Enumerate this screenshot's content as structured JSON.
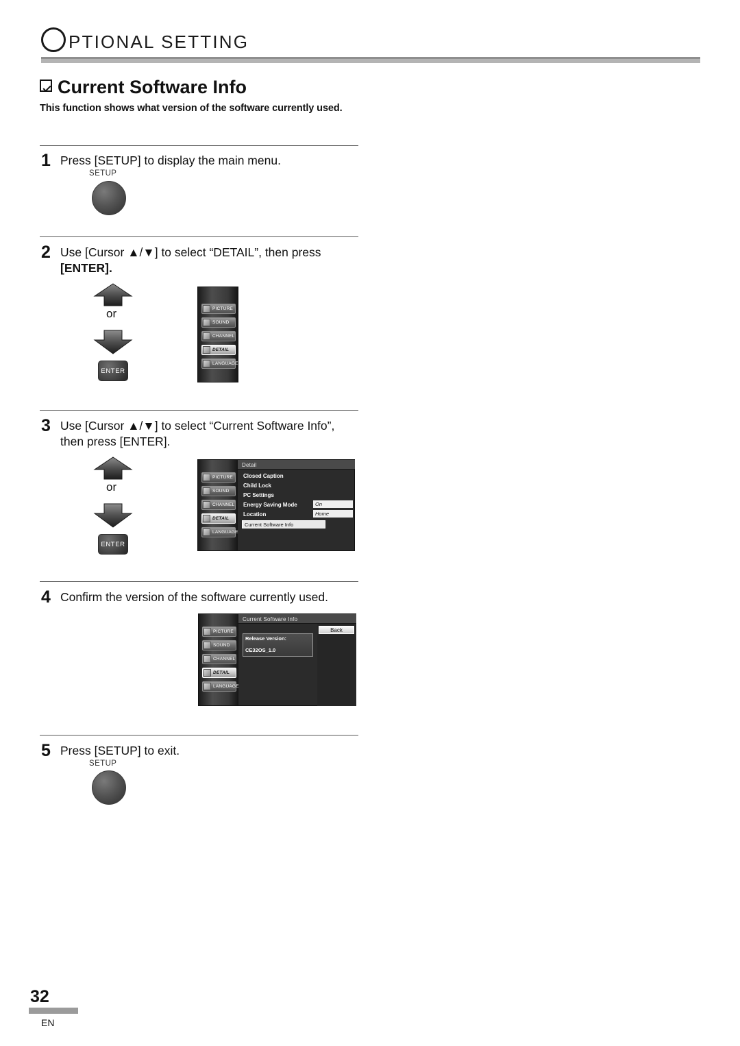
{
  "header": {
    "letter": "O",
    "title": "PTIONAL  SETTING"
  },
  "section": {
    "title": "Current Software Info",
    "subtitle": "This function shows what version of the software currently used."
  },
  "steps": [
    {
      "num": "1",
      "text": "Press [SETUP] to display the main menu.",
      "setup_label": "SETUP"
    },
    {
      "num": "2",
      "line1": "Use [Cursor ▲/▼] to select “DETAIL”, then press",
      "line2": "[ENTER].",
      "or": "or",
      "enter": "ENTER"
    },
    {
      "num": "3",
      "line1": "Use [Cursor ▲/▼] to select “Current Software Info”,",
      "line2": "then press [ENTER].",
      "or": "or",
      "enter": "ENTER"
    },
    {
      "num": "4",
      "text": "Confirm the version of the software currently used."
    },
    {
      "num": "5",
      "text": "Press [SETUP] to exit.",
      "setup_label": "SETUP"
    }
  ],
  "menu": {
    "items": [
      "PICTURE",
      "SOUND",
      "CHANNEL",
      "DETAIL",
      "LANGUAGE"
    ],
    "selected": "DETAIL"
  },
  "osd_detail": {
    "title": "Detail",
    "rows": [
      {
        "label": "Closed Caption",
        "value": ""
      },
      {
        "label": "Child Lock",
        "value": ""
      },
      {
        "label": "PC Settings",
        "value": ""
      },
      {
        "label": "Energy Saving Mode",
        "value": "On"
      },
      {
        "label": "Location",
        "value": "Home"
      }
    ],
    "highlighted": "Current Software Info"
  },
  "osd_info": {
    "title": "Current Software Info",
    "back": "Back",
    "release_label": "Release Version:",
    "release_value": "CE32OS_1.0"
  },
  "footer": {
    "page": "32",
    "lang": "EN"
  }
}
